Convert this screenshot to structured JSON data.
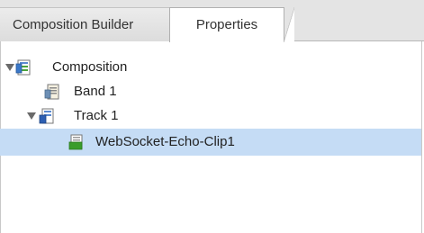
{
  "tabs": {
    "composition_builder": "Composition Builder",
    "properties": "Properties",
    "active": "Properties"
  },
  "tree": {
    "composition": {
      "label": "Composition",
      "expanded": true,
      "icon": "composition-icon"
    },
    "band": {
      "label": "Band 1",
      "icon": "band-icon"
    },
    "track": {
      "label": "Track 1",
      "expanded": true,
      "icon": "track-icon"
    },
    "clip": {
      "label": "WebSocket-Echo-Clip1",
      "selected": true,
      "icon": "clip-icon"
    }
  },
  "colors": {
    "selection": "#c5dcf5",
    "clip_icon_green": "#3a9c2a",
    "track_icon_blue": "#2d5fb3"
  }
}
